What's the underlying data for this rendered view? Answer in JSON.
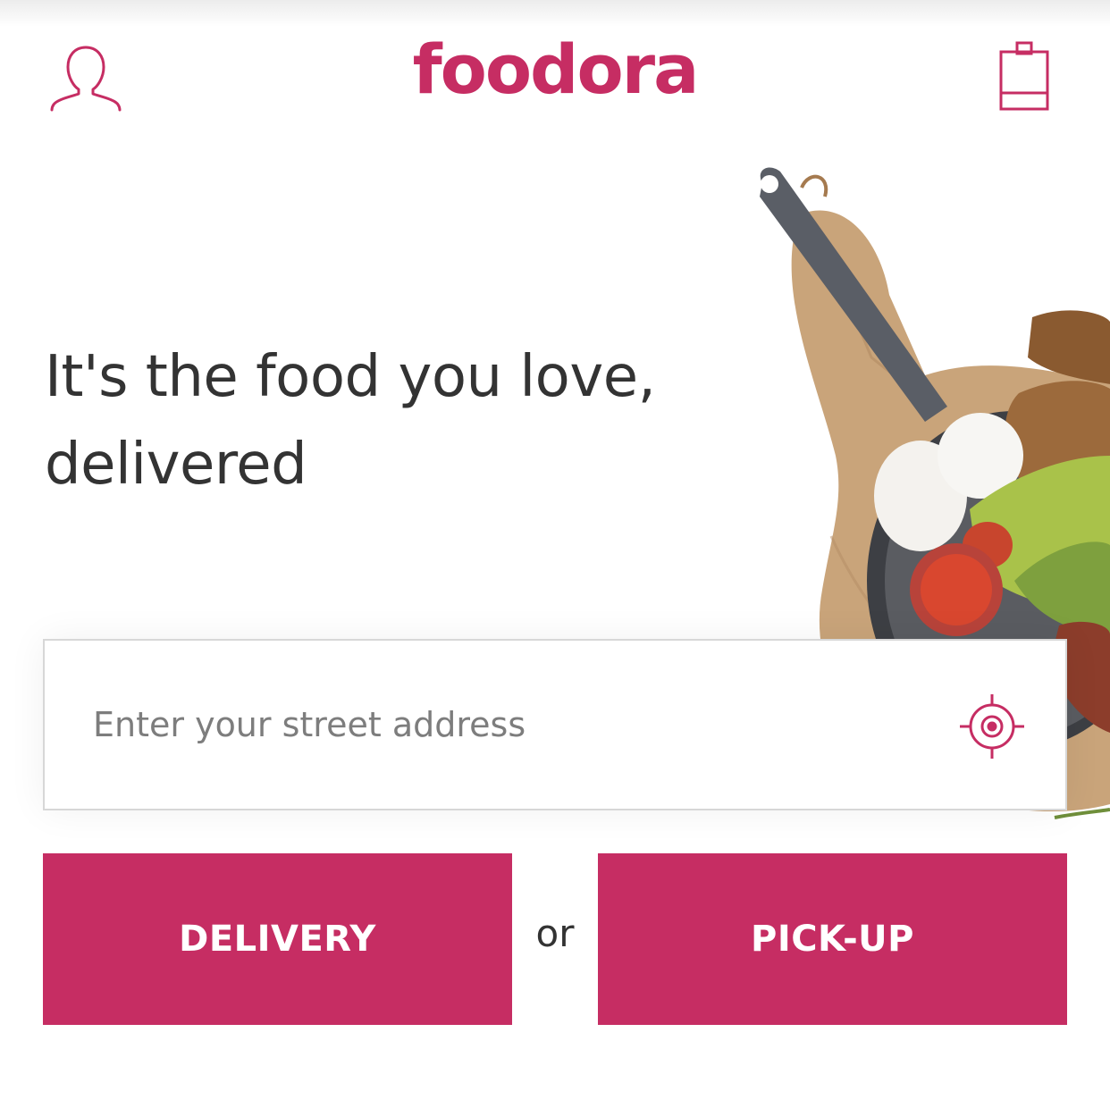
{
  "brand": {
    "name": "foodora",
    "accent_color": "#c62d63"
  },
  "header": {
    "profile_icon": "profile-icon",
    "cart_icon": "shopping-bag-icon"
  },
  "hero": {
    "headline": "It's the food you love, delivered",
    "image_icon": "food-pan-image"
  },
  "address": {
    "placeholder": "Enter your street address",
    "value": "",
    "locate_icon": "location-target-icon"
  },
  "actions": {
    "delivery_label": "DELIVERY",
    "separator": "or",
    "pickup_label": "PICK-UP"
  }
}
